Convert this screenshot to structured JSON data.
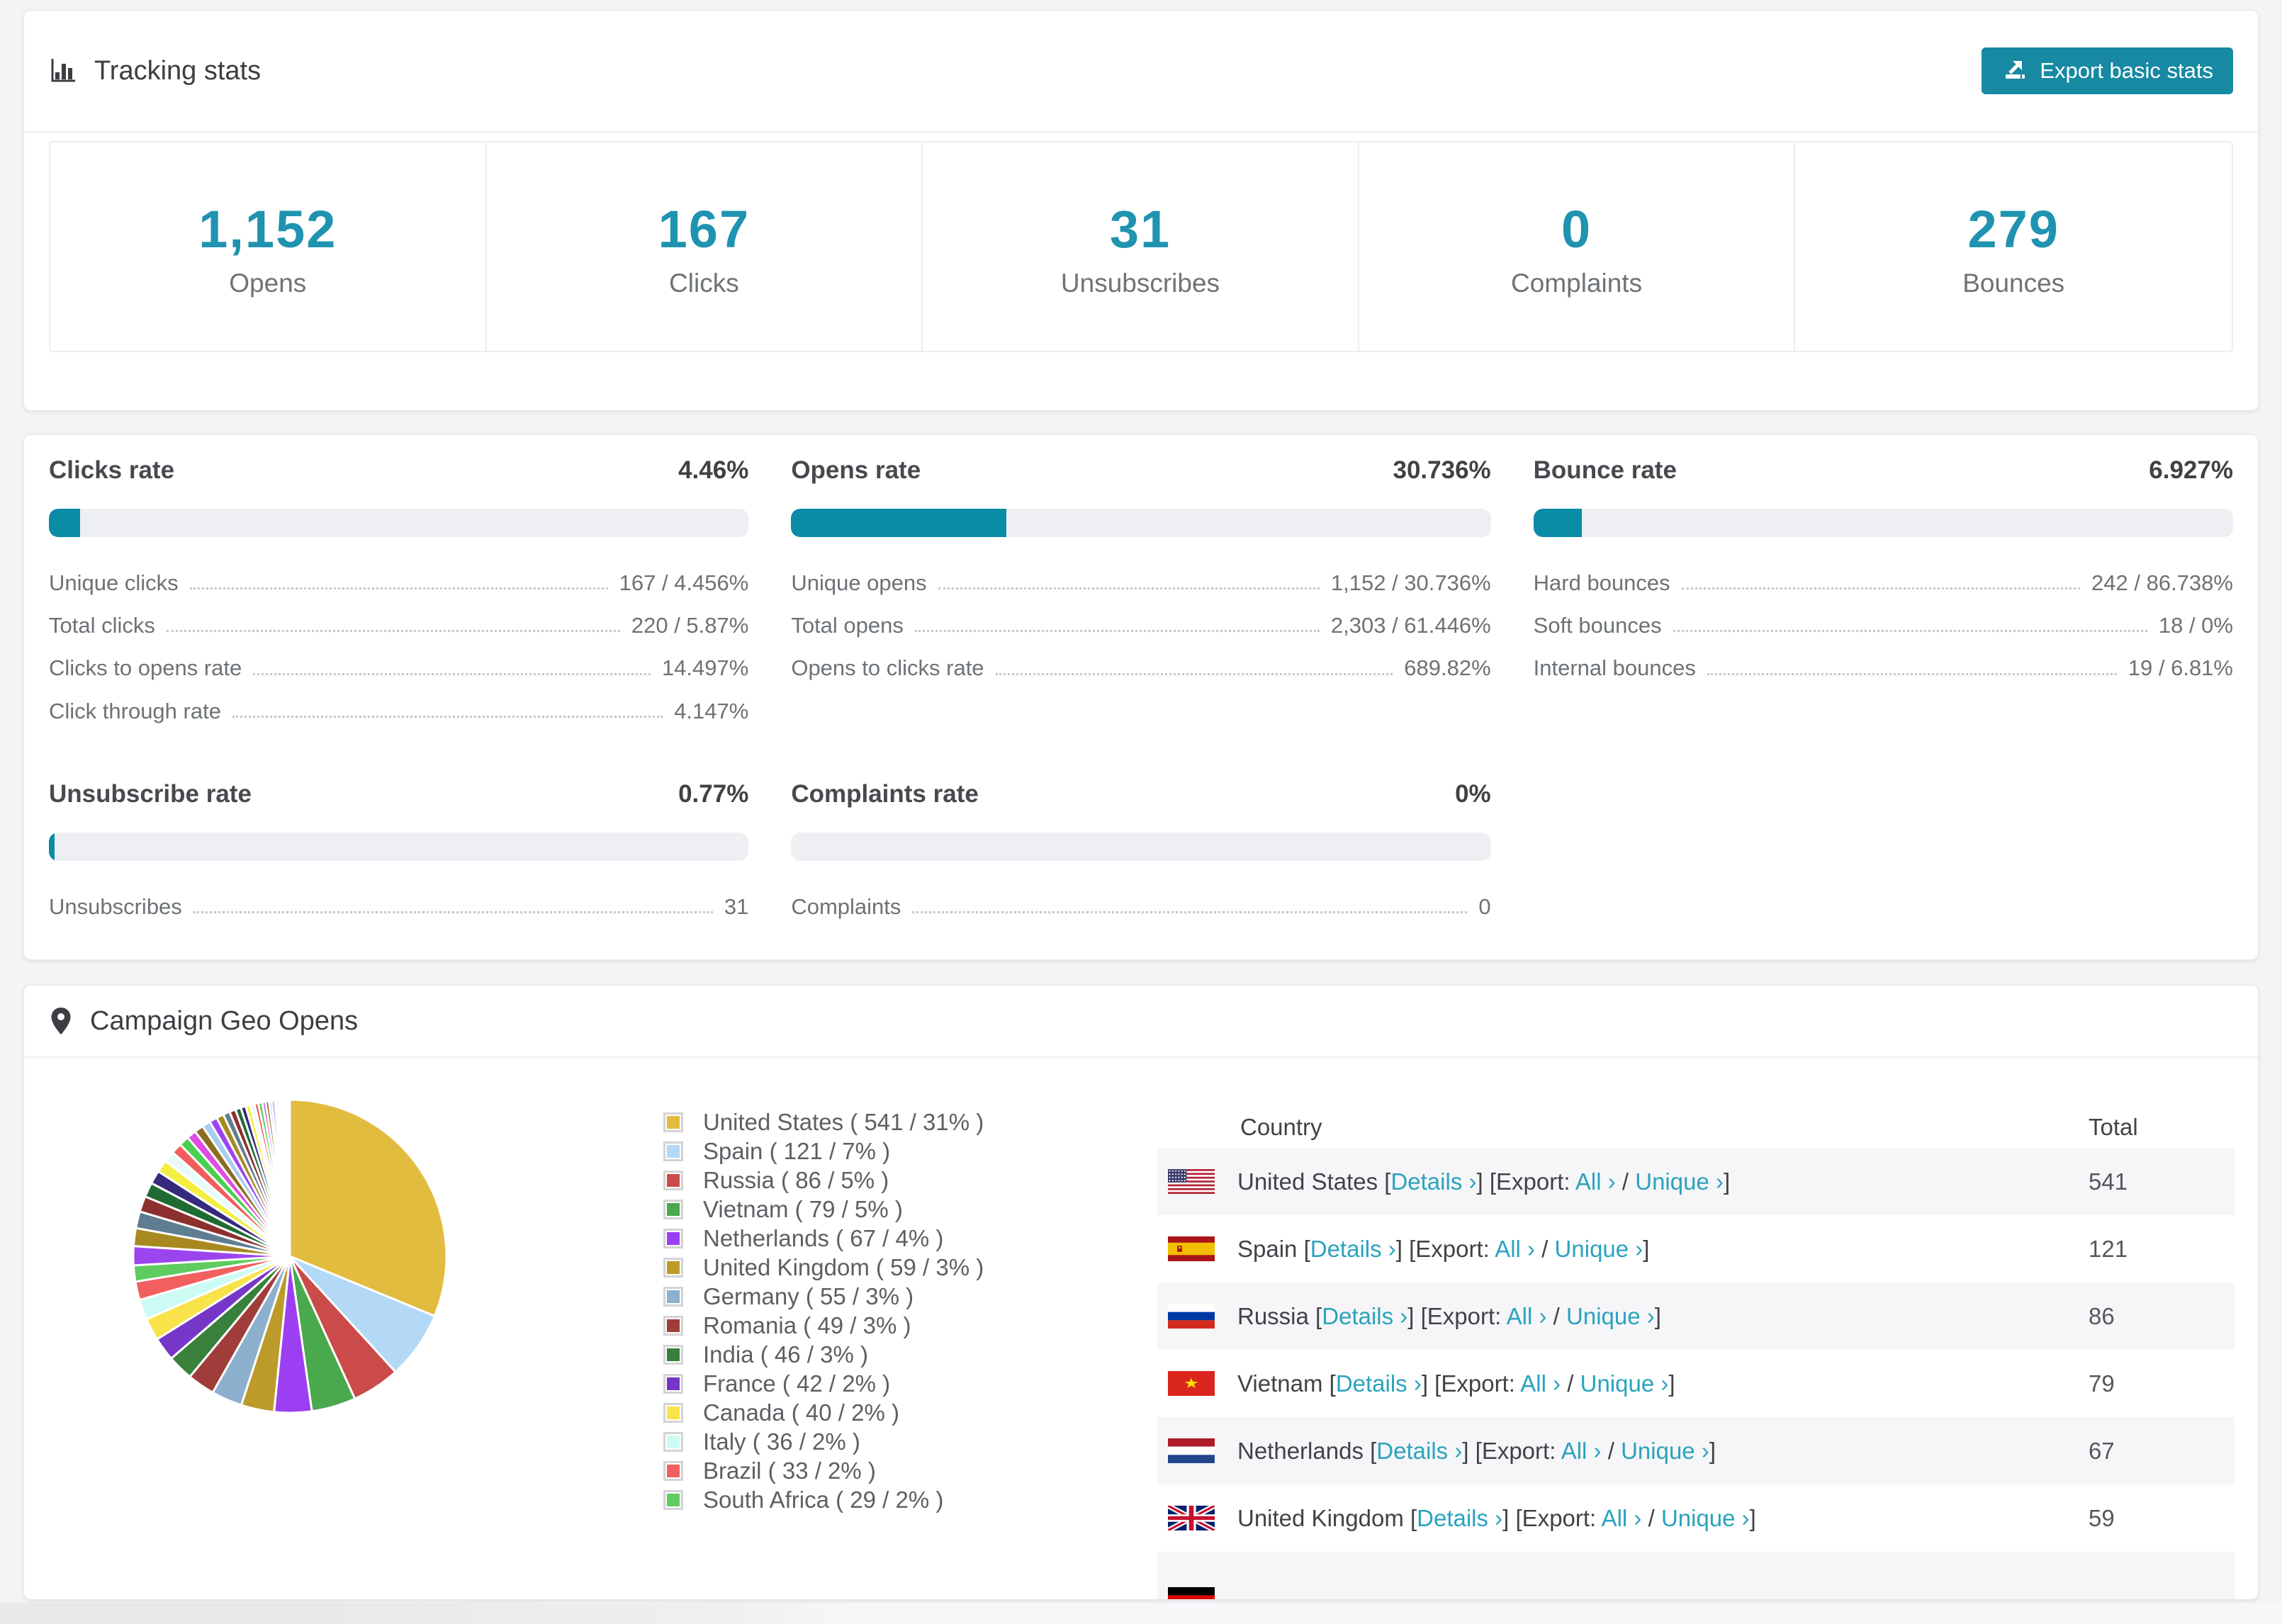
{
  "header": {
    "title": "Tracking stats",
    "export_button": "Export basic stats"
  },
  "summary_stats": [
    {
      "value": "1,152",
      "label": "Opens"
    },
    {
      "value": "167",
      "label": "Clicks"
    },
    {
      "value": "31",
      "label": "Unsubscribes"
    },
    {
      "value": "0",
      "label": "Complaints"
    },
    {
      "value": "279",
      "label": "Bounces"
    }
  ],
  "rates": [
    {
      "title": "Clicks rate",
      "value": "4.46%",
      "percent": 4.46,
      "rows": [
        {
          "label": "Unique clicks",
          "value": "167 / 4.456%"
        },
        {
          "label": "Total clicks",
          "value": "220 / 5.87%"
        },
        {
          "label": "Clicks to opens rate",
          "value": "14.497%"
        },
        {
          "label": "Click through rate",
          "value": "4.147%"
        }
      ]
    },
    {
      "title": "Opens rate",
      "value": "30.736%",
      "percent": 30.736,
      "rows": [
        {
          "label": "Unique opens",
          "value": "1,152 / 30.736%"
        },
        {
          "label": "Total opens",
          "value": "2,303 / 61.446%"
        },
        {
          "label": "Opens to clicks rate",
          "value": "689.82%"
        }
      ]
    },
    {
      "title": "Bounce rate",
      "value": "6.927%",
      "percent": 6.927,
      "rows": [
        {
          "label": "Hard bounces",
          "value": "242 / 86.738%"
        },
        {
          "label": "Soft bounces",
          "value": "18 / 0%"
        },
        {
          "label": "Internal bounces",
          "value": "19 / 6.81%"
        }
      ]
    },
    {
      "title": "Unsubscribe rate",
      "value": "0.77%",
      "percent": 0.77,
      "rows": [
        {
          "label": "Unsubscribes",
          "value": "31"
        }
      ]
    },
    {
      "title": "Complaints rate",
      "value": "0%",
      "percent": 0,
      "rows": [
        {
          "label": "Complaints",
          "value": "0"
        }
      ]
    }
  ],
  "geo": {
    "title": "Campaign Geo Opens",
    "table": {
      "columns": [
        "Country",
        "Total"
      ],
      "links": {
        "details": "Details ›",
        "export_prefix": "Export:",
        "all": "All ›",
        "unique": "Unique ›"
      },
      "rows": [
        {
          "flag": "us",
          "country": "United States",
          "total": "541"
        },
        {
          "flag": "es",
          "country": "Spain",
          "total": "121"
        },
        {
          "flag": "ru",
          "country": "Russia",
          "total": "86"
        },
        {
          "flag": "vn",
          "country": "Vietnam",
          "total": "79"
        },
        {
          "flag": "nl",
          "country": "Netherlands",
          "total": "67"
        },
        {
          "flag": "gb",
          "country": "United Kingdom",
          "total": "59"
        },
        {
          "flag": "de",
          "country": "",
          "total": "",
          "partial": true
        }
      ]
    }
  },
  "chart_data": {
    "type": "pie",
    "title": "Campaign Geo Opens",
    "legend_position": "right",
    "series": [
      {
        "name": "United States",
        "value": 541,
        "pct": "31",
        "color": "#e2bc3f"
      },
      {
        "name": "Spain",
        "value": 121,
        "pct": "7",
        "color": "#b3d9f7"
      },
      {
        "name": "Russia",
        "value": 86,
        "pct": "5",
        "color": "#cb4a4a"
      },
      {
        "name": "Vietnam",
        "value": 79,
        "pct": "5",
        "color": "#4aa84d"
      },
      {
        "name": "Netherlands",
        "value": 67,
        "pct": "4",
        "color": "#9c3ff2"
      },
      {
        "name": "United Kingdom",
        "value": 59,
        "pct": "3",
        "color": "#bc9b2b"
      },
      {
        "name": "Germany",
        "value": 55,
        "pct": "3",
        "color": "#8cb0cd"
      },
      {
        "name": "Romania",
        "value": 49,
        "pct": "3",
        "color": "#a03c3a"
      },
      {
        "name": "India",
        "value": 46,
        "pct": "3",
        "color": "#38803b"
      },
      {
        "name": "France",
        "value": 42,
        "pct": "2",
        "color": "#7637c9"
      },
      {
        "name": "Canada",
        "value": 40,
        "pct": "2",
        "color": "#f8e34a"
      },
      {
        "name": "Italy",
        "value": 36,
        "pct": "2",
        "color": "#ccfbf4"
      },
      {
        "name": "Brazil",
        "value": 33,
        "pct": "2",
        "color": "#f25f5f"
      },
      {
        "name": "South Africa",
        "value": 29,
        "pct": "2",
        "color": "#5ecc5e"
      }
    ],
    "unlabeled_small_slices": {
      "note": "estimated remainder of pie, many thin unlabeled slices",
      "values": [
        34,
        32,
        30,
        28,
        26,
        24,
        22,
        20,
        19,
        18,
        17,
        16,
        15,
        14,
        13,
        12,
        11,
        10,
        9,
        8,
        8,
        7,
        7,
        6,
        6,
        5,
        5,
        4,
        4,
        3,
        3,
        3,
        2,
        2,
        2,
        1,
        1,
        1,
        1
      ],
      "colors": [
        "#9b45ee",
        "#a8891f",
        "#5f7d91",
        "#8d2f2f",
        "#1f6b33",
        "#352a7d",
        "#f3ee3f",
        "#e8fbfa",
        "#f25c5c",
        "#4ad04e",
        "#df4ddf",
        "#8a6d1f",
        "#a9cdf0"
      ]
    }
  },
  "colors": {
    "accent_button": "#1789a2",
    "stat_number": "#1f93af",
    "link": "#2aa3bd",
    "bar_fill": "#0a8ca6",
    "bar_track": "#edeff3"
  }
}
